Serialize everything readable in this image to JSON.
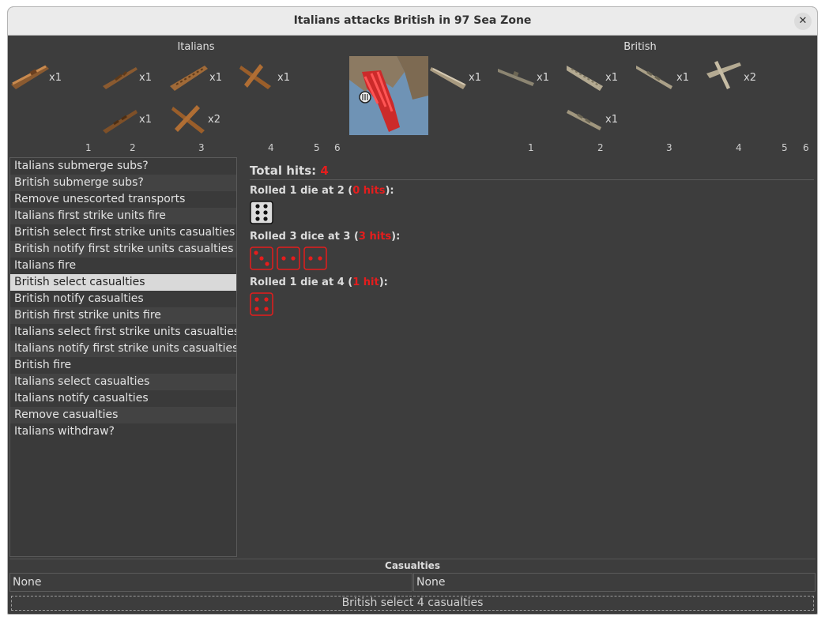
{
  "window": {
    "title": "Italians attacks British in 97 Sea Zone"
  },
  "sides": {
    "attacker": "Italians",
    "defender": "British"
  },
  "attacker_units": [
    {
      "type": "transport-ship",
      "count": "x1"
    },
    {
      "type": "destroyer-ship",
      "count": "x1"
    },
    {
      "type": "carrier-ship",
      "count": "x1"
    },
    {
      "type": "fighter-plane",
      "count": "x1"
    },
    {
      "type": "battleship",
      "count": "x1"
    },
    {
      "type": "bomber-plane",
      "count": "x2"
    }
  ],
  "defender_units": [
    {
      "type": "transport-ship",
      "count": "x1"
    },
    {
      "type": "submarine",
      "count": "x1"
    },
    {
      "type": "carrier-ship",
      "count": "x1"
    },
    {
      "type": "cruiser-ship",
      "count": "x1"
    },
    {
      "type": "fighter-plane",
      "count": "x2"
    },
    {
      "type": "battleship",
      "count": "x1"
    }
  ],
  "attacker_columns": [
    "1",
    "2",
    "3",
    "4",
    "5",
    "6"
  ],
  "defender_columns": [
    "1",
    "2",
    "3",
    "4",
    "5",
    "6"
  ],
  "steps": [
    "Italians submerge subs?",
    "British submerge subs?",
    "Remove unescorted transports",
    "Italians first strike units fire",
    "British select first strike units casualties",
    "British notify first strike units casualties",
    "Italians fire",
    "British select casualties",
    "British notify casualties",
    "British first strike units fire",
    "Italians select first strike units casualties",
    "Italians notify first strike units casualties",
    "British fire",
    "Italians select casualties",
    "Italians notify casualties",
    "Remove casualties",
    "Italians withdraw?"
  ],
  "selected_step_index": 7,
  "results": {
    "total_label": "Total hits: ",
    "total_value": "4",
    "rolls": [
      {
        "prefix": "Rolled 1 die at 2 (",
        "hits": "0 hits",
        "suffix": "):",
        "dice": [
          6
        ],
        "hit": false
      },
      {
        "prefix": "Rolled 3 dice at 3 (",
        "hits": "3 hits",
        "suffix": "):",
        "dice": [
          3,
          2,
          2
        ],
        "hit": true
      },
      {
        "prefix": "Rolled 1 die at 4 (",
        "hits": "1 hit",
        "suffix": "):",
        "dice": [
          4
        ],
        "hit": true
      }
    ]
  },
  "casualties": {
    "title": "Casualties",
    "attacker": "None",
    "defender": "None"
  },
  "status_button": "British select 4 casualties",
  "colors": {
    "hit": "#e51d1d",
    "miss_die": "#111111",
    "background": "#3d3d3d",
    "selected": "#d9d9d9"
  }
}
